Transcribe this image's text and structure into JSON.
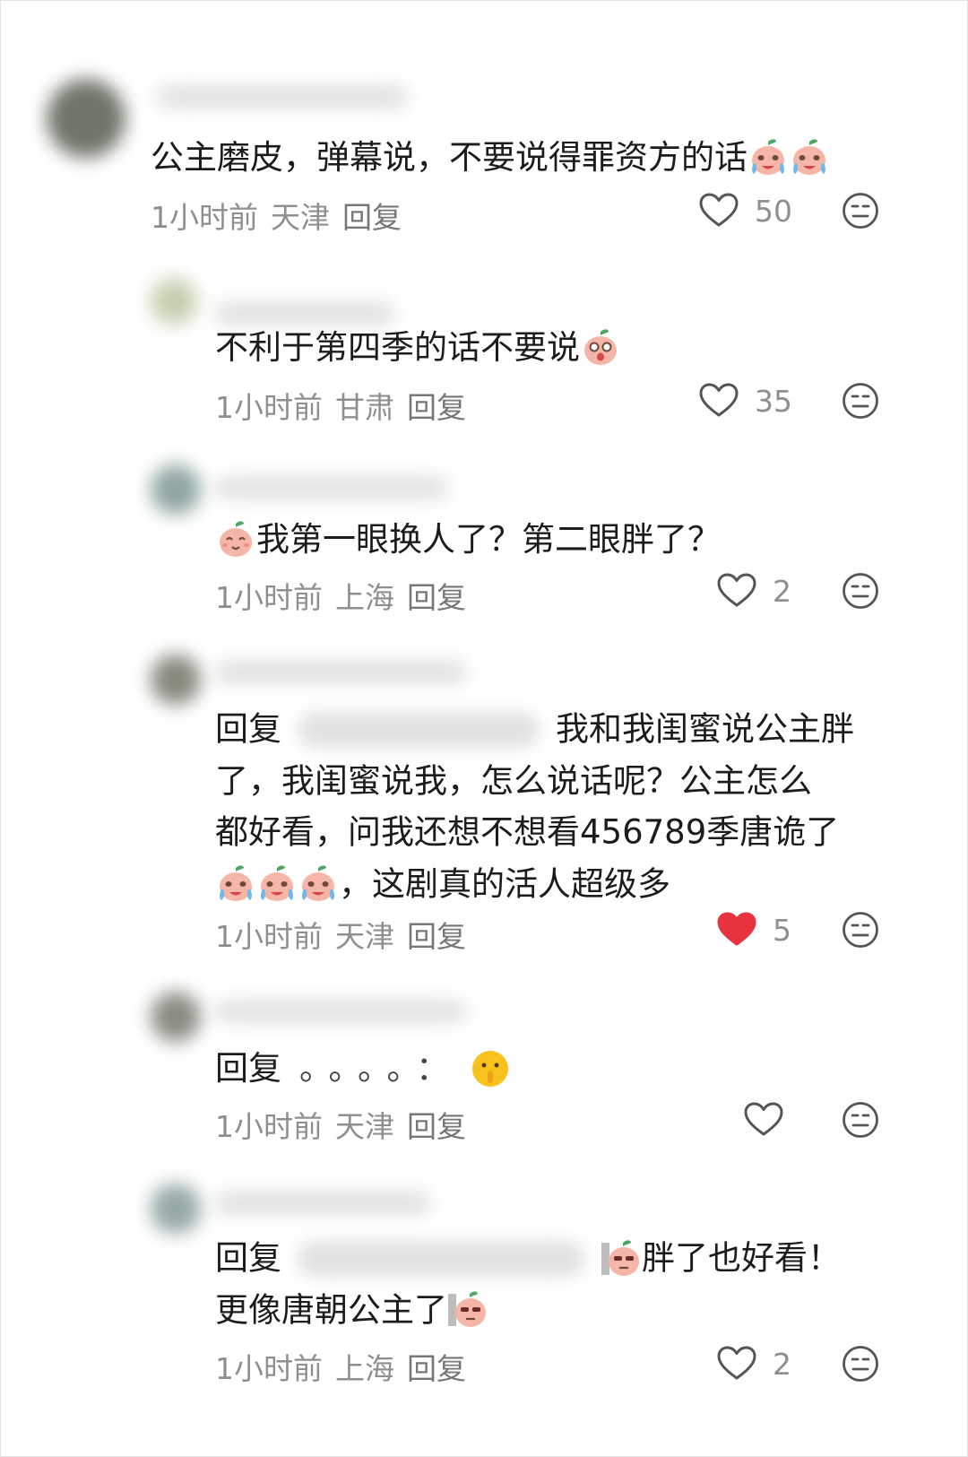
{
  "comments": [
    {
      "text": "公主磨皮，弹幕说，不要说得罪资方的话",
      "time": "1小时前",
      "location": "天津",
      "reply": "回复",
      "likes": "50",
      "liked": false
    },
    {
      "text": "不利于第四季的话不要说",
      "time": "1小时前",
      "location": "甘肃",
      "reply": "回复",
      "likes": "35",
      "liked": false
    },
    {
      "text": "我第一眼换人了？第二眼胖了？",
      "time": "1小时前",
      "location": "上海",
      "reply": "回复",
      "likes": "2",
      "liked": false
    },
    {
      "prefix": "回复",
      "line1": "我和我闺蜜说公主胖",
      "line2": "了，我闺蜜说我，怎么说话呢？公主怎么",
      "line3": "都好看，问我还想不想看456789季唐诡了",
      "line4": "，这剧真的活人超级多",
      "time": "1小时前",
      "location": "天津",
      "reply": "回复",
      "likes": "5",
      "liked": true
    },
    {
      "prefix": "回复",
      "tail": "。。。。：",
      "time": "1小时前",
      "location": "天津",
      "reply": "回复",
      "likes": "",
      "liked": false
    },
    {
      "prefix": "回复",
      "line1": "胖了也好看！",
      "line2": "更像唐朝公主了",
      "time": "1小时前",
      "location": "上海",
      "reply": "回复",
      "likes": "2",
      "liked": false
    }
  ],
  "colors": {
    "text": "#1c1c1c",
    "meta": "#8f8f8f",
    "heart_active": "#e8333f",
    "icon": "#555555"
  }
}
